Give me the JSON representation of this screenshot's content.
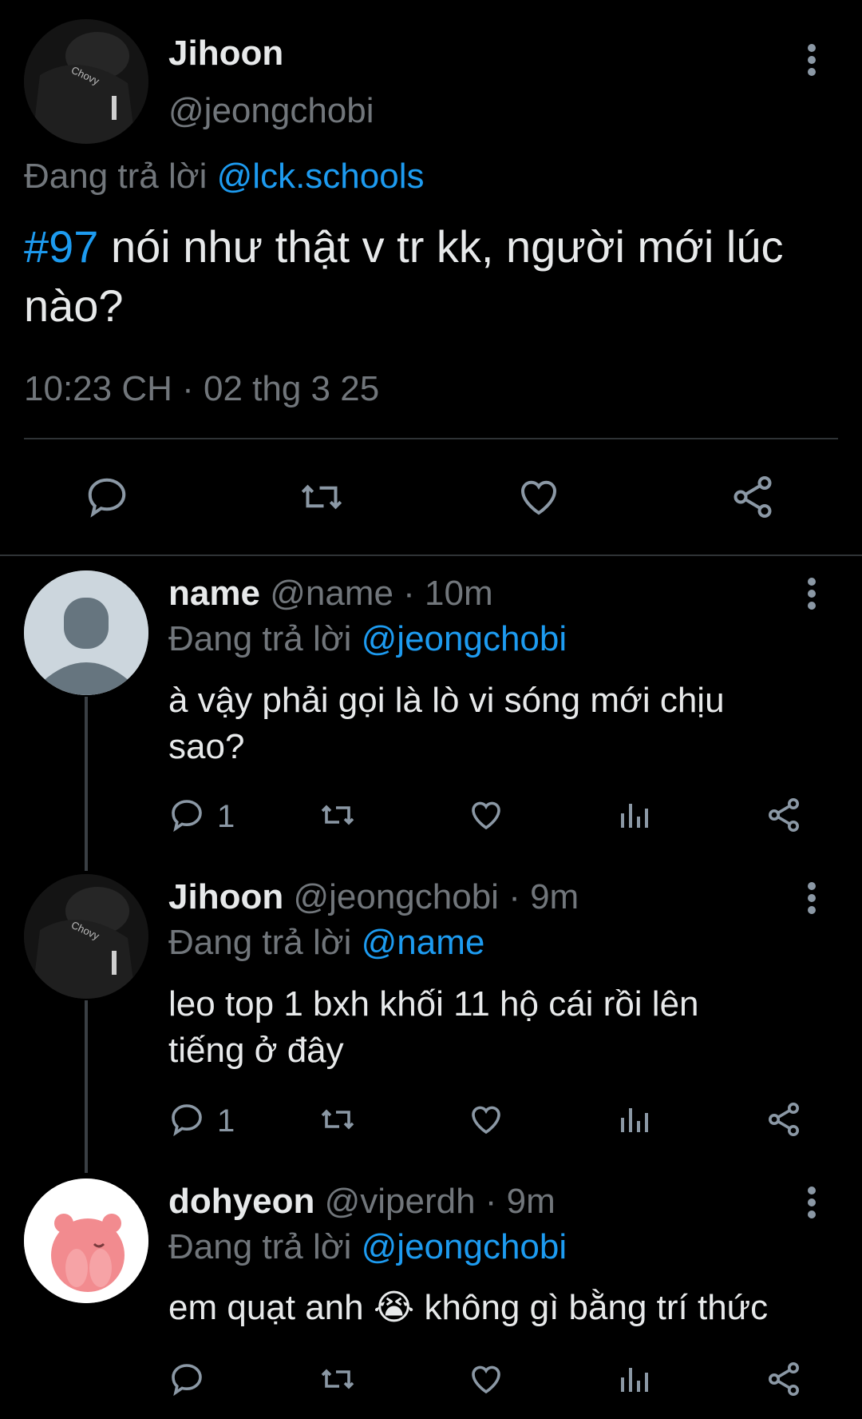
{
  "main_tweet": {
    "display_name": "Jihoon",
    "handle": "@jeongchobi",
    "reply_prefix": "Đang trả lời",
    "reply_to": "@lck.schools",
    "hashtag": "#97",
    "text_line1": " nói như thật v tr kk, người mới lúc",
    "text_line2": "nào?",
    "timestamp": "10:23 CH · 02 thg 3 25"
  },
  "replies": [
    {
      "display_name": "name",
      "handle": "@name",
      "time": "· 10m",
      "reply_prefix": "Đang trả lời",
      "reply_to": "@jeongchobi",
      "text_line1": "à vậy phải gọi là lò vi sóng mới chịu",
      "text_line2": "sao?",
      "reply_count": "1"
    },
    {
      "display_name": "Jihoon",
      "handle": "@jeongchobi",
      "time": "· 9m",
      "reply_prefix": "Đang trả lời",
      "reply_to": "@name",
      "text_line1": "leo top 1 bxh khối 11 hộ cái rồi lên",
      "text_line2": "tiếng ở đây",
      "reply_count": "1"
    },
    {
      "display_name": "dohyeon",
      "handle": "@viperdh",
      "time": "· 9m",
      "reply_prefix": "Đang trả lời",
      "reply_to": "@jeongchobi",
      "text_before_emoji": "em quạt anh ",
      "emoji": "😭",
      "text_after_emoji": " không gì bằng trí thức",
      "reply_count": ""
    }
  ],
  "colors": {
    "background": "#000000",
    "text": "#e7e9ea",
    "muted": "#71767b",
    "link": "#1d9bf0",
    "icon": "#8b98a5"
  }
}
